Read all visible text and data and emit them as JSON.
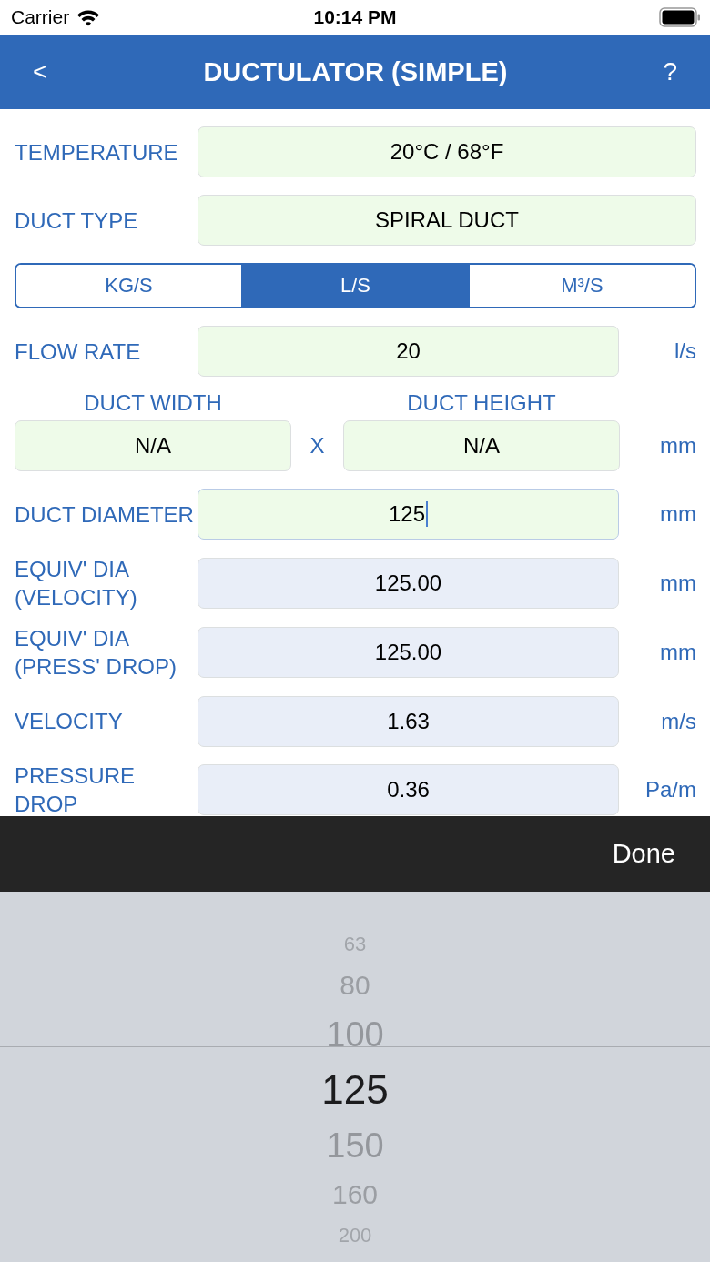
{
  "status_bar": {
    "carrier": "Carrier",
    "time": "10:14 PM"
  },
  "nav_bar": {
    "back": "<",
    "title": "DUCTULATOR (SIMPLE)",
    "help": "?"
  },
  "rows": [
    {
      "kind": "wide",
      "label": "TEMPERATURE",
      "field": {
        "kind": "input",
        "value": "20°C / 68°F",
        "focused": false
      }
    },
    {
      "kind": "wide",
      "label": "DUCT TYPE",
      "field": {
        "kind": "input",
        "value": "SPIRAL DUCT",
        "focused": false
      }
    },
    {
      "kind": "segmented",
      "segments": [
        {
          "label": "KG/S",
          "selected": false
        },
        {
          "label": "L/S",
          "selected": true
        },
        {
          "label": "M³/S",
          "selected": false
        }
      ]
    },
    {
      "kind": "field",
      "label": "FLOW RATE",
      "field": {
        "kind": "input",
        "value": "20",
        "focused": false
      },
      "unit": "l/s"
    },
    {
      "kind": "dims",
      "headers": [
        "DUCT WIDTH",
        "DUCT HEIGHT"
      ],
      "fields": [
        {
          "kind": "input",
          "value": "N/A",
          "focused": false
        },
        {
          "kind": "input",
          "value": "N/A",
          "focused": false
        }
      ],
      "separator": "X",
      "unit": "mm"
    },
    {
      "kind": "field",
      "label": "DUCT DIAMETER",
      "field": {
        "kind": "input",
        "value": "125",
        "focused": true
      },
      "unit": "mm"
    },
    {
      "kind": "field",
      "label": "EQUIV' DIA (VELOCITY)",
      "field": {
        "kind": "output",
        "value": "125.00",
        "focused": false
      },
      "unit": "mm"
    },
    {
      "kind": "field",
      "label": "EQUIV' DIA (PRESS' DROP)",
      "field": {
        "kind": "output",
        "value": "125.00",
        "focused": false
      },
      "unit": "mm"
    },
    {
      "kind": "field",
      "label": "VELOCITY",
      "field": {
        "kind": "output",
        "value": "1.63",
        "focused": false
      },
      "unit": "m/s"
    },
    {
      "kind": "field",
      "label": "PRESSURE DROP",
      "field": {
        "kind": "output",
        "value": "0.36",
        "focused": false
      },
      "unit": "Pa/m"
    }
  ],
  "toolbar": {
    "done": "Done"
  },
  "picker": {
    "items": [
      {
        "label": "63",
        "selected": false
      },
      {
        "label": "80",
        "selected": false
      },
      {
        "label": "100",
        "selected": false
      },
      {
        "label": "125",
        "selected": true
      },
      {
        "label": "150",
        "selected": false
      },
      {
        "label": "160",
        "selected": false
      },
      {
        "label": "200",
        "selected": false
      }
    ]
  }
}
